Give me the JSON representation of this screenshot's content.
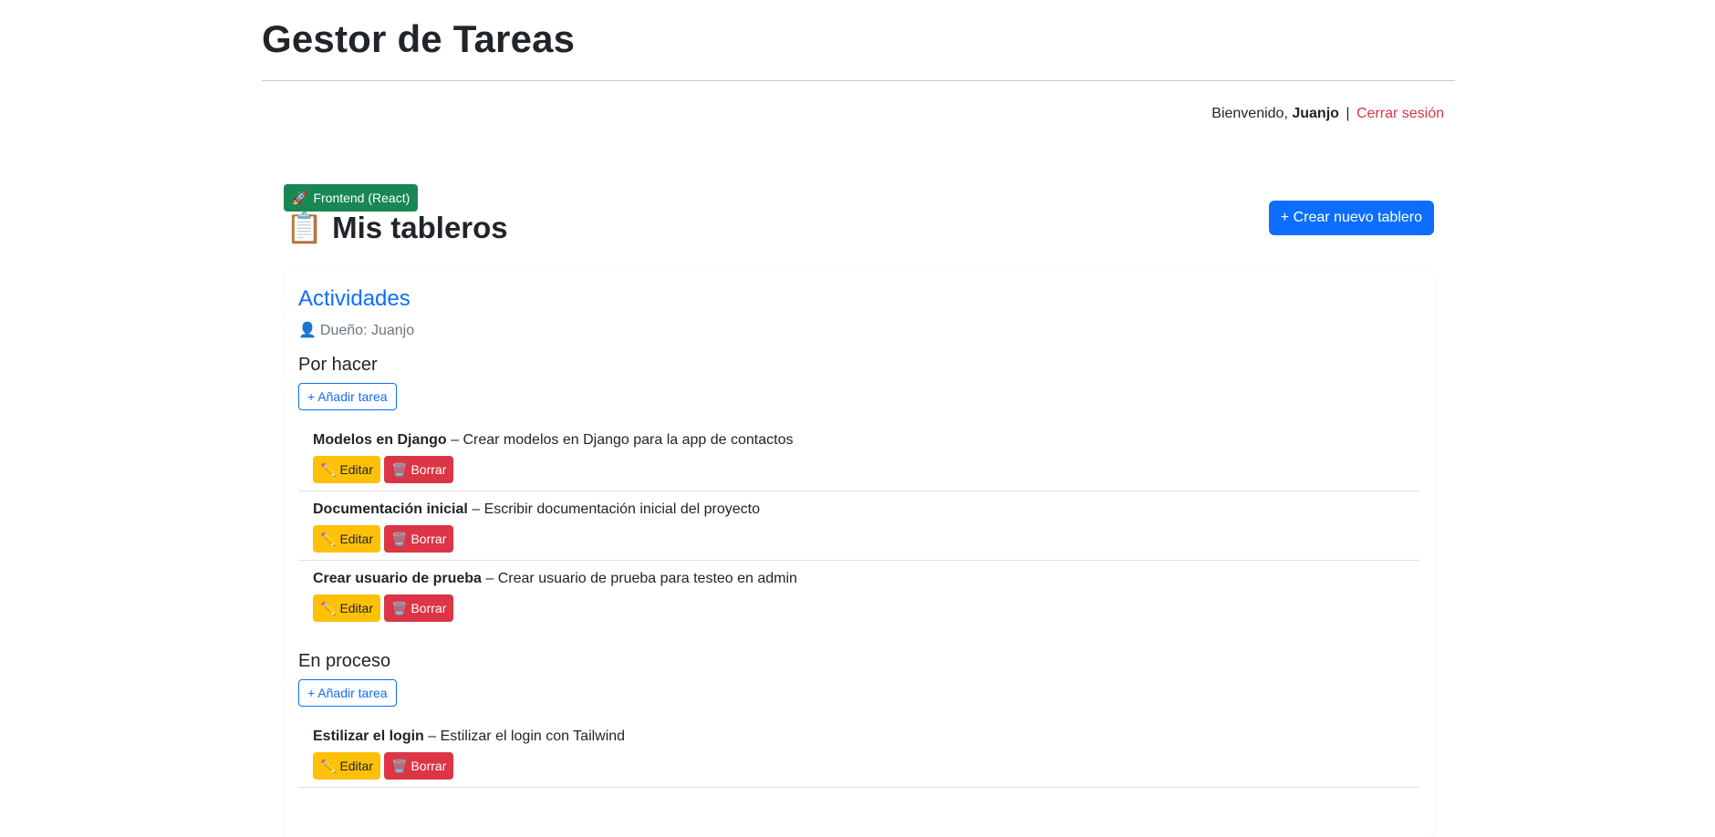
{
  "app": {
    "title": "Gestor de Tareas"
  },
  "user_bar": {
    "welcome": "Bienvenido,",
    "username": "Juanjo",
    "separator": "|",
    "logout": "Cerrar sesión"
  },
  "badge": {
    "icon": "🚀",
    "label": "Frontend (React)"
  },
  "page": {
    "icon": "📋",
    "title": "Mis tableros",
    "create_button": "+ Crear nuevo tablero"
  },
  "board": {
    "title": "Actividades",
    "owner_icon": "👤",
    "owner_label": "Dueño: Juanjo"
  },
  "columns": [
    {
      "title": "Por hacer",
      "add_label": "+ Añadir tarea",
      "tasks": [
        {
          "name": "Modelos en Django",
          "desc": "– Crear modelos en Django para la app de contactos"
        },
        {
          "name": "Documentación inicial",
          "desc": "– Escribir documentación inicial del proyecto"
        },
        {
          "name": "Crear usuario de prueba",
          "desc": "– Crear usuario de prueba para testeo en admin"
        }
      ]
    },
    {
      "title": "En proceso",
      "add_label": "+ Añadir tarea",
      "tasks": [
        {
          "name": "Estilizar el login",
          "desc": "– Estilizar el login con Tailwind"
        }
      ]
    }
  ],
  "task_actions": {
    "edit_icon": "✏️",
    "edit_label": "Editar",
    "delete_icon": "🗑️",
    "delete_label": "Borrar"
  },
  "colors": {
    "primary": "#0d6efd",
    "success": "#198754",
    "warning": "#ffc107",
    "danger": "#dc3545"
  }
}
